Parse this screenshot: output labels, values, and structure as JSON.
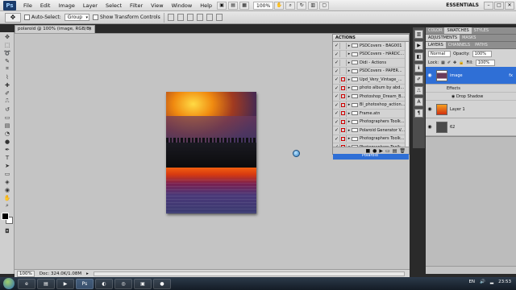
{
  "menubar": {
    "logo": "Ps",
    "items": [
      "File",
      "Edit",
      "Image",
      "Layer",
      "Select",
      "Filter",
      "View",
      "Window",
      "Help"
    ],
    "zoom": "100%",
    "workspace": "ESSENTIALS"
  },
  "options": {
    "auto_select_label": "Auto-Select:",
    "auto_select_value": "Group",
    "transform_label": "Show Transform Controls"
  },
  "document": {
    "tab_title": "polaroid @ 100% (image, RGB/8) *",
    "status_zoom": "100%",
    "status_doc": "Doc: 324.0K/1.08M"
  },
  "actions_panel": {
    "title": "ACTIONS",
    "items": [
      {
        "label": "PSDCovers - BAG001",
        "dialog": false
      },
      {
        "label": "PSDCovers - HARDC...",
        "dialog": false
      },
      {
        "label": "Didi - Actions",
        "dialog": false
      },
      {
        "label": "PSDCovers - PAPER...",
        "dialog": false
      },
      {
        "label": "Upd_Very_Vintage_...",
        "dialog": true
      },
      {
        "label": "photo album by abd...",
        "dialog": true
      },
      {
        "label": "Photoshop_Dream_B...",
        "dialog": true
      },
      {
        "label": "Bl_photoshop_action...",
        "dialog": true
      },
      {
        "label": "Frame.atn",
        "dialog": true
      },
      {
        "label": "Photographers Toolk...",
        "dialog": true
      },
      {
        "label": "Polaroid Generator V...",
        "dialog": true
      },
      {
        "label": "Photographers Toolk...",
        "dialog": true
      },
      {
        "label": "Photographers Toolk...",
        "dialog": true
      }
    ],
    "selected": "Polaroid"
  },
  "right_top_tabs": [
    "COLOR",
    "SWATCHES",
    "STYLES"
  ],
  "right_mid_tabs": [
    "ADJUSTMENTS",
    "MASKS"
  ],
  "layers_panel": {
    "tabs": [
      "LAYERS",
      "CHANNELS",
      "PATHS"
    ],
    "blend_mode": "Normal",
    "opacity_label": "Opacity:",
    "opacity": "100%",
    "lock_label": "Lock:",
    "fill_label": "Fill:",
    "fill": "100%",
    "layers": [
      {
        "name": "image",
        "active": true
      },
      {
        "name": "Layer 1",
        "active": false
      },
      {
        "name": "62",
        "active": false
      }
    ],
    "effects_label": "Effects",
    "effect_item": "Drop Shadow"
  },
  "taskbar": {
    "lang": "EN",
    "time": "23:53"
  }
}
